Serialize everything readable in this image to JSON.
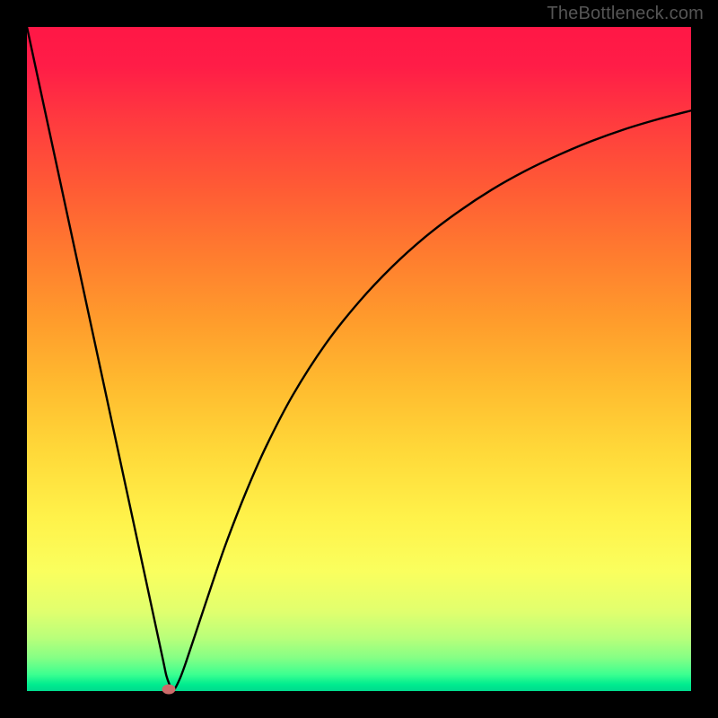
{
  "watermark": "TheBottleneck.com",
  "chart_data": {
    "type": "line",
    "title": "",
    "xlabel": "",
    "ylabel": "",
    "xlim": [
      0,
      100
    ],
    "ylim": [
      0,
      100
    ],
    "grid": false,
    "series": [
      {
        "name": "bottleneck-curve",
        "x": [
          0,
          2,
          4,
          6,
          8,
          10,
          12,
          14,
          16,
          18,
          19.5,
          20.5,
          21,
          21.5,
          22,
          23,
          24,
          26,
          28,
          30,
          33,
          36,
          40,
          45,
          50,
          55,
          60,
          65,
          70,
          75,
          80,
          85,
          90,
          95,
          100
        ],
        "y": [
          100,
          90.7,
          81.4,
          72.1,
          62.8,
          53.5,
          44.2,
          34.9,
          25.6,
          16.3,
          9.3,
          4.65,
          2.3,
          0.9,
          0,
          1.8,
          4.5,
          10.5,
          16.5,
          22.3,
          30.0,
          36.8,
          44.5,
          52.3,
          58.6,
          63.9,
          68.4,
          72.2,
          75.5,
          78.3,
          80.7,
          82.8,
          84.6,
          86.1,
          87.4
        ]
      }
    ],
    "marker": {
      "x": 21.4,
      "y": 0.3
    },
    "gradient_stops": [
      {
        "pos": 0,
        "color": "#ff1746"
      },
      {
        "pos": 14,
        "color": "#ff3a3f"
      },
      {
        "pos": 34,
        "color": "#ff7b2f"
      },
      {
        "pos": 54,
        "color": "#ffbb2f"
      },
      {
        "pos": 74,
        "color": "#fff24a"
      },
      {
        "pos": 92,
        "color": "#b9ff7a"
      },
      {
        "pos": 100,
        "color": "#00d98d"
      }
    ]
  }
}
